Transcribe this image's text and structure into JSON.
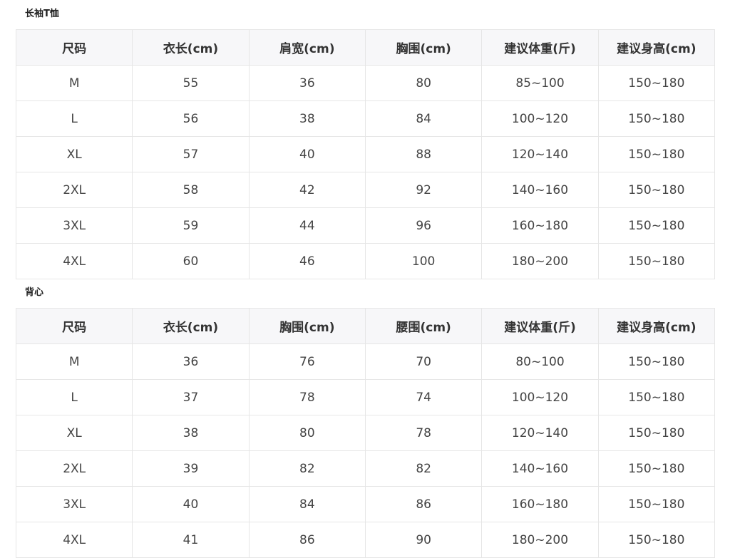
{
  "sections": [
    {
      "title": "长袖T恤",
      "headers": [
        "尺码",
        "衣长(cm)",
        "肩宽(cm)",
        "胸围(cm)",
        "建议体重(斤)",
        "建议身高(cm)"
      ],
      "rows": [
        [
          "M",
          "55",
          "36",
          "80",
          "85~100",
          "150~180"
        ],
        [
          "L",
          "56",
          "38",
          "84",
          "100~120",
          "150~180"
        ],
        [
          "XL",
          "57",
          "40",
          "88",
          "120~140",
          "150~180"
        ],
        [
          "2XL",
          "58",
          "42",
          "92",
          "140~160",
          "150~180"
        ],
        [
          "3XL",
          "59",
          "44",
          "96",
          "160~180",
          "150~180"
        ],
        [
          "4XL",
          "60",
          "46",
          "100",
          "180~200",
          "150~180"
        ]
      ]
    },
    {
      "title": "背心",
      "headers": [
        "尺码",
        "衣长(cm)",
        "胸围(cm)",
        "腰围(cm)",
        "建议体重(斤)",
        "建议身高(cm)"
      ],
      "rows": [
        [
          "M",
          "36",
          "76",
          "70",
          "80~100",
          "150~180"
        ],
        [
          "L",
          "37",
          "78",
          "74",
          "100~120",
          "150~180"
        ],
        [
          "XL",
          "38",
          "80",
          "78",
          "120~140",
          "150~180"
        ],
        [
          "2XL",
          "39",
          "82",
          "82",
          "140~160",
          "150~180"
        ],
        [
          "3XL",
          "40",
          "84",
          "86",
          "160~180",
          "150~180"
        ],
        [
          "4XL",
          "41",
          "86",
          "90",
          "180~200",
          "150~180"
        ]
      ]
    }
  ]
}
